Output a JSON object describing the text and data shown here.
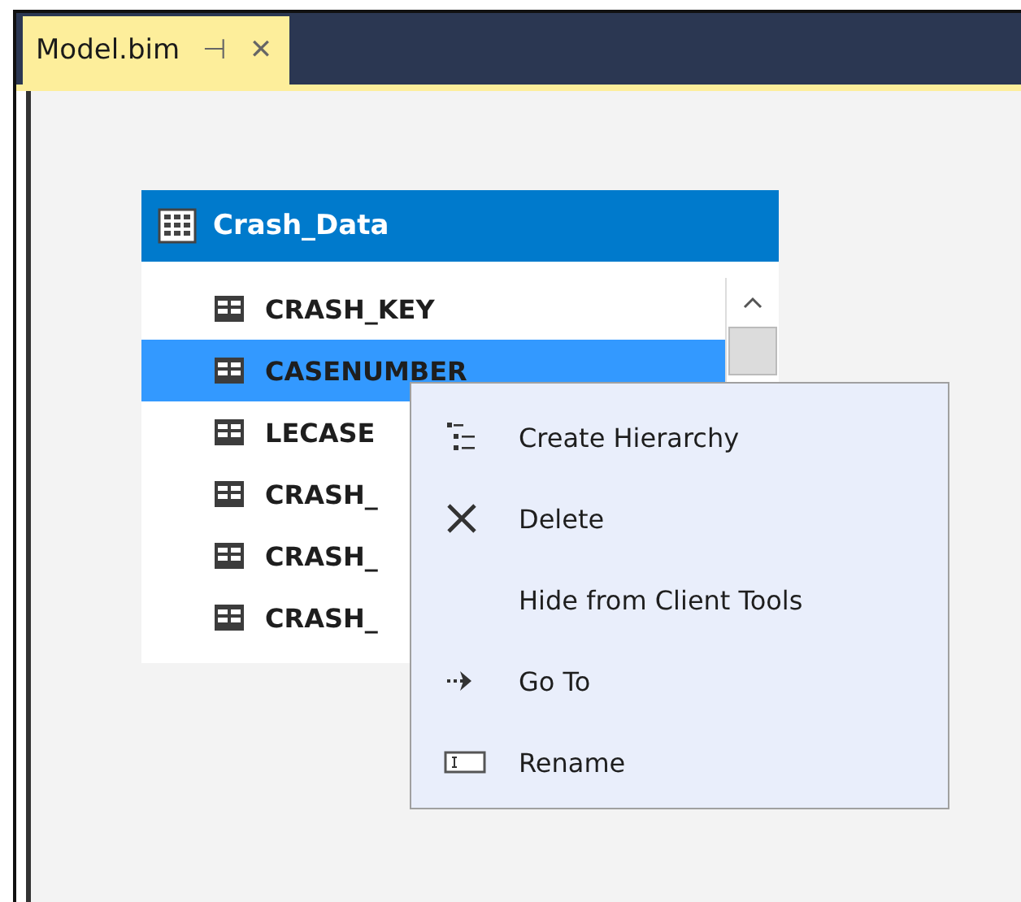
{
  "tab": {
    "title": "Model.bim",
    "pin": "⊣",
    "close": "✕",
    "selected": true
  },
  "table": {
    "title": "Crash_Data",
    "columns": [
      {
        "name": "CRASH_KEY",
        "selected": false
      },
      {
        "name": "CASENUMBER",
        "selected": true
      },
      {
        "name": "LECASE",
        "selected": false
      },
      {
        "name": "CRASH_",
        "selected": false
      },
      {
        "name": "CRASH_",
        "selected": false
      },
      {
        "name": "CRASH_",
        "selected": false
      }
    ]
  },
  "context_menu": {
    "items": [
      {
        "label": "Create Hierarchy",
        "kind": "hierarchy"
      },
      {
        "label": "Delete",
        "kind": "delete"
      },
      {
        "label": "Hide from Client Tools",
        "kind": "plain"
      },
      {
        "label": "Go To",
        "kind": "goto"
      },
      {
        "label": "Rename",
        "kind": "rename"
      }
    ]
  }
}
